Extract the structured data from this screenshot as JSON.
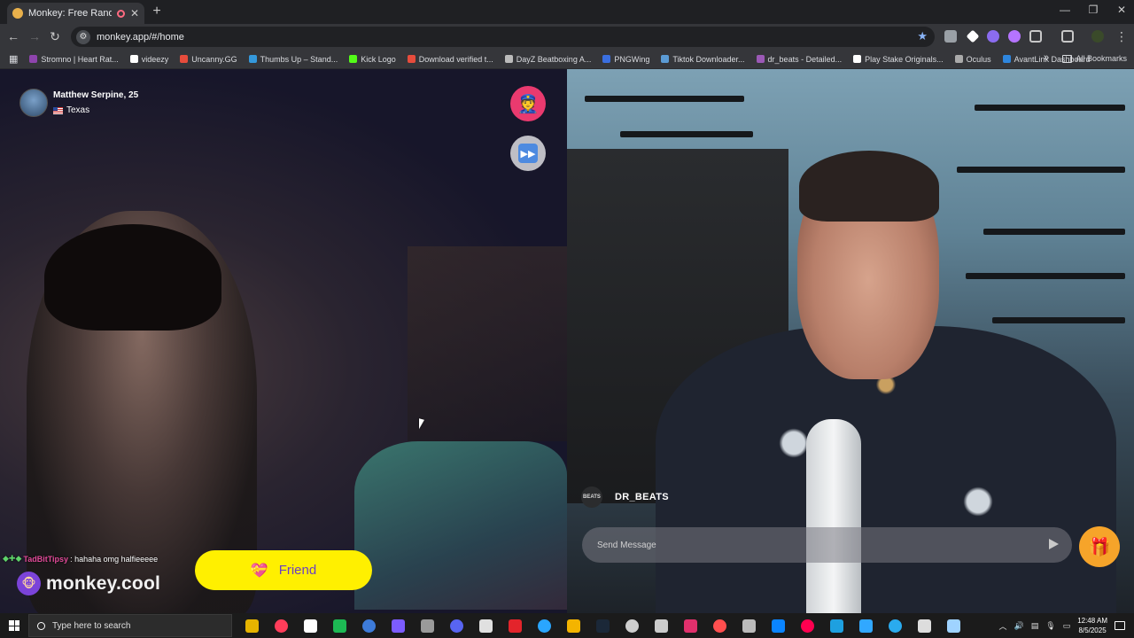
{
  "browser": {
    "tab_title": "Monkey: Free Random Vide",
    "new_tab": "+",
    "url": "monkey.app/#/home",
    "bookmarks": [
      {
        "label": "Stromno | Heart Rat...",
        "color": "#8e44ad"
      },
      {
        "label": "videezy",
        "color": "#ffffff"
      },
      {
        "label": "Uncanny.GG",
        "color": "#e74c3c"
      },
      {
        "label": "Thumbs Up – Stand...",
        "color": "#3498db"
      },
      {
        "label": "Kick Logo",
        "color": "#53fc18"
      },
      {
        "label": "Download verified t...",
        "color": "#e74c3c"
      },
      {
        "label": "DayZ Beatboxing A...",
        "color": "#bbbbbb"
      },
      {
        "label": "PNGWing",
        "color": "#3a6fe0"
      },
      {
        "label": "Tiktok Downloader...",
        "color": "#5b9bd5"
      },
      {
        "label": "dr_beats - Detailed...",
        "color": "#9b59b6"
      },
      {
        "label": "Play Stake Originals...",
        "color": "#ffffff"
      },
      {
        "label": "Oculus",
        "color": "#aaaaaa"
      },
      {
        "label": "AvantLink Dashboard",
        "color": "#2e86de"
      }
    ],
    "all_bookmarks": "All Bookmarks"
  },
  "match": {
    "name": "Matthew Serpine, 25",
    "location": "Texas"
  },
  "chat": {
    "username": "TadBitTipsy",
    "message": ": hahaha omg halfieeeee"
  },
  "brand": {
    "name": "monkey.cool"
  },
  "friend_button": {
    "label": "Friend"
  },
  "self": {
    "name": "DR_BEATS",
    "avatar_text": "BEATS"
  },
  "message_input": {
    "placeholder": "Send Message"
  },
  "taskbar": {
    "search_placeholder": "Type here to search",
    "time": "12:48 AM",
    "date": "8/5/2025",
    "icons": [
      "#e6b400",
      "#ff3d5a",
      "#ffffff",
      "#1db954",
      "#3d7bd9",
      "#7c5cff",
      "#9a9a9a",
      "#5865f2",
      "#e0e0e0",
      "#e3242b",
      "#2aa6ff",
      "#f4b400",
      "#1b2838",
      "#cfcfcf",
      "#cccccc",
      "#e1306c",
      "#ff4f4f",
      "#bbbbbb",
      "#0a84ff",
      "#ff0050",
      "#1ea0e0",
      "#31a8ff",
      "#2aabee",
      "#dddddd",
      "#9fd3ff"
    ]
  }
}
